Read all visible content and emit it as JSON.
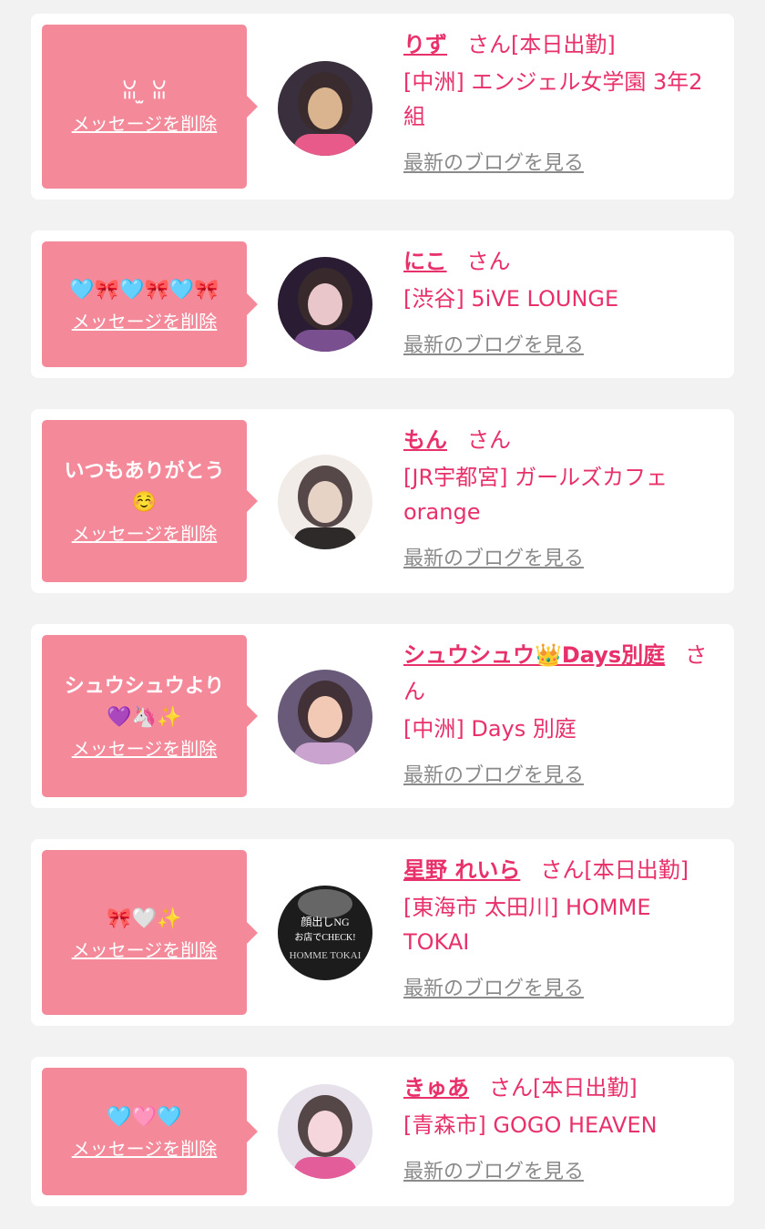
{
  "common": {
    "suffix": "さん",
    "delete_label": "メッセージを削除",
    "blog_label": "最新のブログを見る"
  },
  "colors": {
    "accent": "#e8306a",
    "bubble": "#f4899a",
    "background": "#f2f2f2",
    "link_gray": "#8a8a8a"
  },
  "cards": [
    {
      "message": "ꈍ ̫ ꈍ",
      "name": "りず",
      "suffix": "さん[本日出勤]",
      "shop": "[中洲] エンジェル女学園 3年2組",
      "avatar_icon": "girl-avatar"
    },
    {
      "message": "🩵🎀🩵🎀🩵🎀",
      "name": "にこ",
      "suffix": "さん",
      "shop": "[渋谷] 5iVE LOUNGE",
      "avatar_icon": "girl-avatar"
    },
    {
      "message": "いつもありがとう\n☺️",
      "name": "もん",
      "suffix": "さん",
      "shop": "[JR宇都宮] ガールズカフェorange",
      "avatar_icon": "girl-avatar"
    },
    {
      "message": "シュウシュウより\n💜🦄✨",
      "name": "シュウシュウ👑Days別庭",
      "suffix": "さん",
      "shop": "[中洲] Days 別庭",
      "avatar_icon": "girl-avatar"
    },
    {
      "message": "🎀🤍✨",
      "name": "星野 れいら",
      "suffix": "さん[本日出勤]",
      "shop": "[東海市 太田川] HOMME TOKAI",
      "avatar_icon": "shop-banner",
      "avatar_text": "顔出しNG お店でCHECK! HOMME TOKAI"
    },
    {
      "message": "🩵🩷🩵",
      "name": "きゅあ",
      "suffix": "さん[本日出勤]",
      "shop": "[青森市] GOGO HEAVEN",
      "avatar_icon": "girl-avatar"
    }
  ]
}
